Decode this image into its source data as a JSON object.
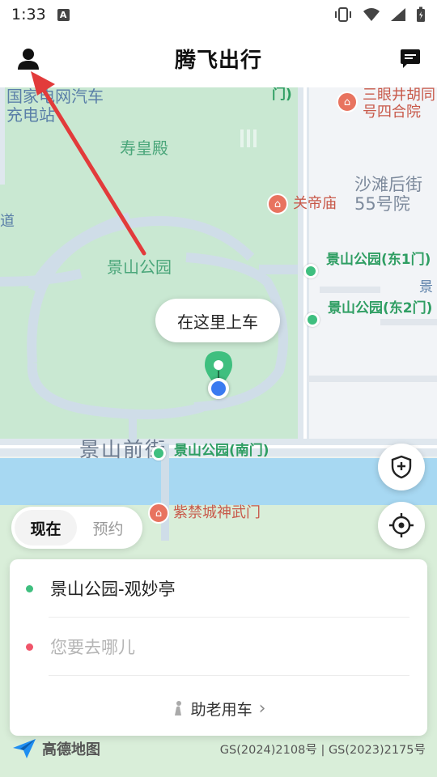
{
  "status_bar": {
    "time": "1:33",
    "notification_icon": "A"
  },
  "header": {
    "title": "腾飞出行",
    "profile_icon": "user-icon",
    "message_icon": "message-icon"
  },
  "map": {
    "labels": {
      "charging_station": "国家电网汽车充电站",
      "shouhuang_hall": "寿皇殿",
      "sanyanjing": "三眼井胡同号四合院",
      "guandi_temple": "关帝庙",
      "shatan": "沙滩后街55号院",
      "jingshan_park": "景山公园",
      "east1_gate": "景山公园(东1门)",
      "east2_gate": "景山公园(东2门)",
      "jingshan_front_street": "景山前街",
      "south_gate": "景山公园(南门)",
      "shenwu_gate": "紫禁城神武门",
      "top_gate_fragment": "门)",
      "left_fragment": "道",
      "right_fragment": "景"
    },
    "pickup_bubble": "在这里上车"
  },
  "mode_toggle": {
    "now": "现在",
    "reserve": "预约"
  },
  "route_card": {
    "origin": "景山公园-观妙亭",
    "destination_placeholder": "您要去哪儿",
    "elder_service": "助老用车",
    "elder_chevron": "›"
  },
  "footer": {
    "map_brand": "高德地图",
    "license": "GS(2024)2108号 | GS(2023)2175号"
  },
  "colors": {
    "accent_green": "#3fbf7f",
    "origin_dot": "#3fbf7f",
    "destination_dot": "#f0556a",
    "annotation_arrow": "#e23b3b"
  }
}
